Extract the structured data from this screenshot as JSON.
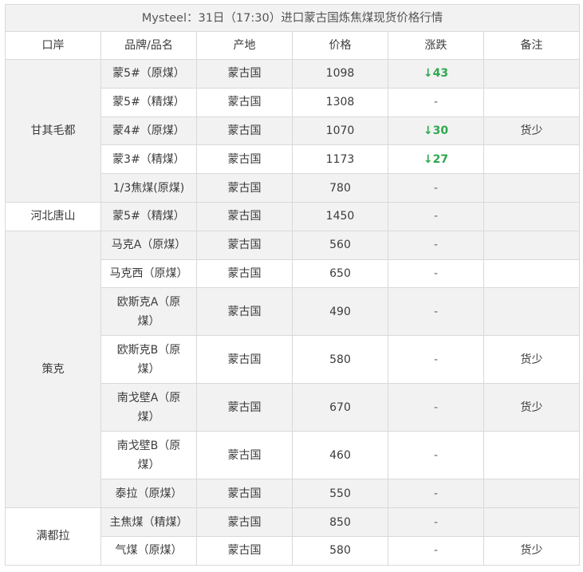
{
  "title": "Mysteel：31日（17:30）进口蒙古国炼焦煤现货价格行情",
  "columns": [
    "口岸",
    "品牌/品名",
    "产地",
    "价格",
    "涨跌",
    "备注"
  ],
  "groups": [
    {
      "port": "甘其毛都",
      "shade": true,
      "rows": [
        {
          "name": "蒙5#（原煤）",
          "origin": "蒙古国",
          "price": "1098",
          "change": "↓43",
          "note": ""
        },
        {
          "name": "蒙5#（精煤）",
          "origin": "蒙古国",
          "price": "1308",
          "change": "-",
          "note": ""
        },
        {
          "name": "蒙4#（原煤）",
          "origin": "蒙古国",
          "price": "1070",
          "change": "↓30",
          "note": "货少"
        },
        {
          "name": "蒙3#（精煤）",
          "origin": "蒙古国",
          "price": "1173",
          "change": "↓27",
          "note": ""
        },
        {
          "name": "1/3焦煤(原煤)",
          "origin": "蒙古国",
          "price": "780",
          "change": "-",
          "note": ""
        }
      ]
    },
    {
      "port": "河北唐山",
      "shade": false,
      "rows": [
        {
          "name": "蒙5#（精煤）",
          "origin": "蒙古国",
          "price": "1450",
          "change": "-",
          "note": ""
        }
      ]
    },
    {
      "port": "策克",
      "shade": true,
      "rows": [
        {
          "name": "马克A（原煤）",
          "origin": "蒙古国",
          "price": "560",
          "change": "-",
          "note": ""
        },
        {
          "name": "马克西（原煤）",
          "origin": "蒙古国",
          "price": "650",
          "change": "-",
          "note": ""
        },
        {
          "name": "欧斯克A（原煤）",
          "origin": "蒙古国",
          "price": "490",
          "change": "-",
          "note": ""
        },
        {
          "name": "欧斯克B（原煤）",
          "origin": "蒙古国",
          "price": "580",
          "change": "-",
          "note": "货少"
        },
        {
          "name": "南戈壁A（原煤）",
          "origin": "蒙古国",
          "price": "670",
          "change": "-",
          "note": "货少"
        },
        {
          "name": "南戈壁B（原煤）",
          "origin": "蒙古国",
          "price": "460",
          "change": "-",
          "note": ""
        },
        {
          "name": "泰拉（原煤）",
          "origin": "蒙古国",
          "price": "550",
          "change": "-",
          "note": ""
        }
      ]
    },
    {
      "port": "满都拉",
      "shade": false,
      "rows": [
        {
          "name": "主焦煤（精煤）",
          "origin": "蒙古国",
          "price": "850",
          "change": "-",
          "note": ""
        },
        {
          "name": "气煤（原煤）",
          "origin": "蒙古国",
          "price": "580",
          "change": "-",
          "note": "货少"
        }
      ]
    }
  ]
}
